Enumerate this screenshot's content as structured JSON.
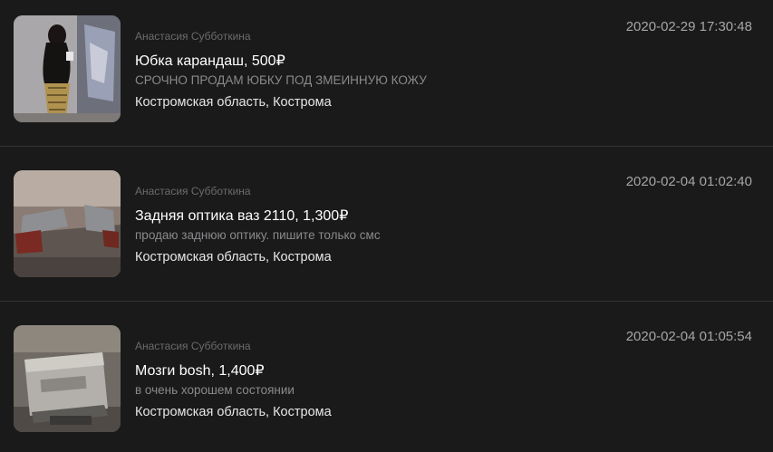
{
  "listings": [
    {
      "author": "Анастасия Субботкина",
      "title": "Юбка карандаш, 500₽",
      "description": "СРОЧНО ПРОДАМ ЮБКУ ПОД ЗМЕИННУЮ КОЖУ",
      "location": "Костромская область, Кострома",
      "date": "2020-02-29 17:30:48",
      "thumbnail": "photo-woman-in-skirt"
    },
    {
      "author": "Анастасия Субботкина",
      "title": "Задняя оптика ваз 2110, 1,300₽",
      "description": "продаю заднюю оптику. пишите только смс",
      "location": "Костромская область, Кострома",
      "date": "2020-02-04 01:02:40",
      "thumbnail": "photo-car-tail-lights"
    },
    {
      "author": "Анастасия Субботкина",
      "title": "Мозги bosh, 1,400₽",
      "description": "в очень хорошем состоянии",
      "location": "Костромская область, Кострома",
      "date": "2020-02-04 01:05:54",
      "thumbnail": "photo-ecu-unit"
    }
  ]
}
